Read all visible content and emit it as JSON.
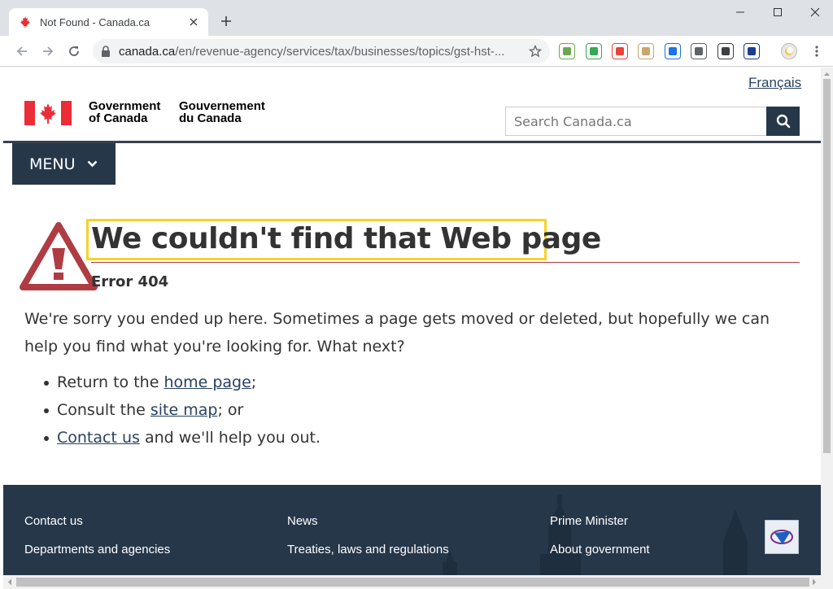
{
  "browser": {
    "tab_title": "Not Found - Canada.ca",
    "url_host": "canada.ca",
    "url_path": "/en/revenue-agency/services/tax/businesses/topics/gst-hst-...",
    "extensions": [
      {
        "icon": "puzzle-ext-icon",
        "color": "#6aa84f"
      },
      {
        "icon": "mail-ext-icon",
        "color": "#34a853"
      },
      {
        "icon": "camera-ext-icon",
        "color": "#ea4335"
      },
      {
        "icon": "box-ext-icon",
        "color": "#c9a66b"
      },
      {
        "icon": "translate-ext-icon",
        "color": "#1a73e8"
      },
      {
        "icon": "eyes-ext-icon",
        "color": "#5f6368"
      },
      {
        "icon": "screenshot-ext-icon",
        "color": "#3c4043"
      },
      {
        "icon": "search-ext-icon",
        "color": "#1a3d8f"
      }
    ]
  },
  "header": {
    "language_link": "Français",
    "gov_en_line1": "Government",
    "gov_en_line2": "of Canada",
    "gov_fr_line1": "Gouvernement",
    "gov_fr_line2": "du Canada",
    "search_placeholder": "Search Canada.ca",
    "menu_label": "MENU"
  },
  "main": {
    "title": "We couldn't find that Web page",
    "error_code": "Error 404",
    "intro": "We're sorry you ended up here. Sometimes a page gets moved or deleted, but hopefully we can help you find what you're looking for. What next?",
    "items": [
      {
        "before": "Return to the ",
        "link": "home page",
        "after": ";"
      },
      {
        "before": "Consult the ",
        "link": "site map",
        "after": "; or"
      },
      {
        "before": "",
        "link": "Contact us",
        "after": " and we'll help you out."
      }
    ]
  },
  "footer": {
    "col1": [
      "Contact us",
      "Departments and agencies"
    ],
    "col2": [
      "News",
      "Treaties, laws and regulations"
    ],
    "col3": [
      "Prime Minister",
      "About government"
    ]
  },
  "colors": {
    "brand_navy": "#26374a",
    "link": "#284162",
    "flag_red": "#eb2d37",
    "warning_red": "#af3c43",
    "highlight": "#f5d327"
  }
}
